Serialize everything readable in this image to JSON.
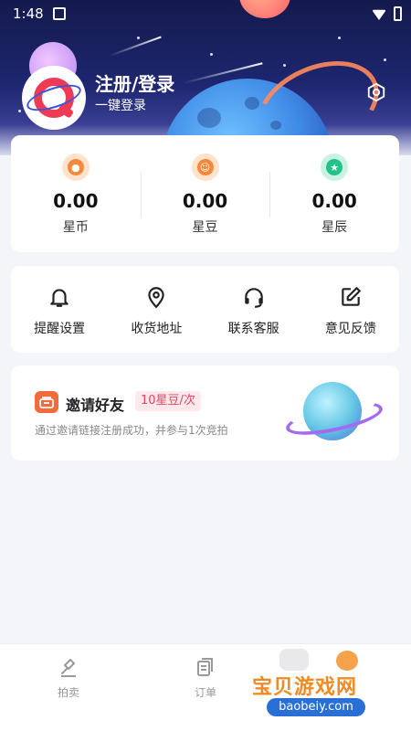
{
  "status_bar": {
    "time": "1:48"
  },
  "header": {
    "login_title": "注册/登录",
    "login_subtitle": "一键登录"
  },
  "wallet": {
    "items": [
      {
        "value": "0.00",
        "label": "星币",
        "icon": "star-coin-icon",
        "color": "#f5883a"
      },
      {
        "value": "0.00",
        "label": "星豆",
        "icon": "star-bean-icon",
        "color": "#f5883a"
      },
      {
        "value": "0.00",
        "label": "星辰",
        "icon": "star-dust-icon",
        "color": "#22c28a"
      }
    ]
  },
  "menu": {
    "items": [
      {
        "label": "提醒设置",
        "icon": "bell-icon"
      },
      {
        "label": "收货地址",
        "icon": "location-pin-icon"
      },
      {
        "label": "联系客服",
        "icon": "headset-icon"
      },
      {
        "label": "意见反馈",
        "icon": "edit-icon"
      }
    ]
  },
  "invite": {
    "title": "邀请好友",
    "badge": "10星豆/次",
    "description": "通过邀请链接注册成功，并参与1次竞拍",
    "icon": "invite-icon",
    "accent": "#e2445c"
  },
  "bottom_nav": {
    "items": [
      {
        "label": "拍卖",
        "icon": "auction-hammer-icon"
      },
      {
        "label": "订单",
        "icon": "orders-icon"
      },
      {
        "label": "",
        "icon": "profile-icon"
      }
    ]
  },
  "watermark": {
    "text": "宝贝游戏网",
    "url": "baobeiy.com"
  }
}
